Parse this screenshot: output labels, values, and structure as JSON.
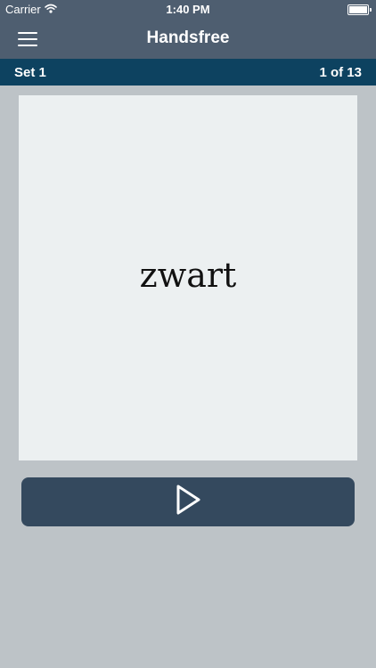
{
  "status_bar": {
    "carrier": "Carrier",
    "time": "1:40 PM",
    "icons": [
      "wifi-icon",
      "battery-icon"
    ]
  },
  "nav": {
    "title": "Handsfree",
    "menu_icon": "hamburger-menu-icon"
  },
  "set_bar": {
    "set_name": "Set 1",
    "progress": "1 of 13"
  },
  "card": {
    "word": "zwart"
  },
  "controls": {
    "play_icon": "play-icon"
  },
  "colors": {
    "nav_background": "#4e5e70",
    "set_bar_background": "#0d4260",
    "page_background": "#bdc3c7",
    "card_background": "#ecf0f1",
    "button_background": "#34495e"
  }
}
